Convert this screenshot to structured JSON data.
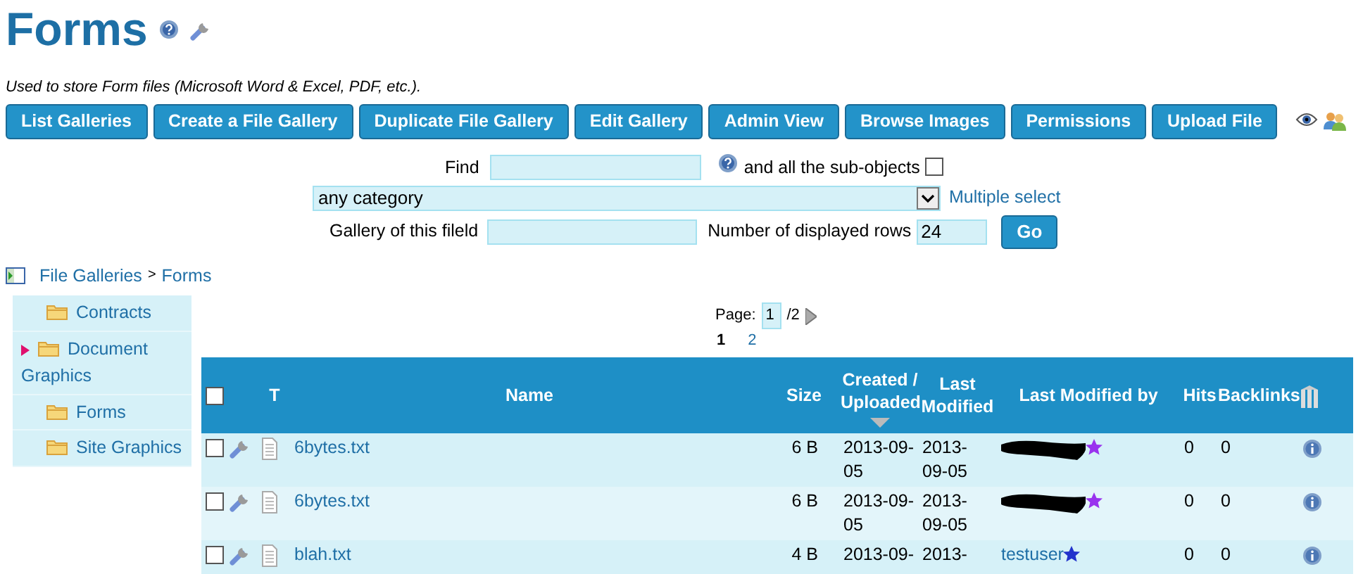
{
  "page": {
    "title": "Forms",
    "description": "Used to store Form files (Microsoft Word & Excel, PDF, etc.)."
  },
  "buttons": [
    {
      "label": "List Galleries"
    },
    {
      "label": "Create a File Gallery"
    },
    {
      "label": "Duplicate File Gallery"
    },
    {
      "label": "Edit Gallery"
    },
    {
      "label": "Admin View"
    },
    {
      "label": "Browse Images"
    },
    {
      "label": "Permissions"
    },
    {
      "label": "Upload File"
    }
  ],
  "search": {
    "find_label": "Find",
    "sub_objects_label": "and all the sub-objects",
    "sub_objects_checked": false,
    "category": "any category",
    "multiple_select": "Multiple select",
    "gallery_label": "Gallery of this fileld",
    "rows_label": "Number of displayed rows",
    "rows_value": "24",
    "go": "Go"
  },
  "breadcrumb": {
    "items": [
      "File Galleries",
      "Forms"
    ],
    "separator": ">"
  },
  "sidebar": [
    {
      "label": "Contracts",
      "has_children": false
    },
    {
      "label": "Document Graphics",
      "has_children": true
    },
    {
      "label": "Forms",
      "has_children": false
    },
    {
      "label": "Site Graphics",
      "has_children": false
    }
  ],
  "pagination": {
    "label": "Page:",
    "current": "1",
    "total": "/2",
    "pages": [
      {
        "label": "1",
        "selected": true
      },
      {
        "label": "2",
        "selected": false
      }
    ]
  },
  "table": {
    "select_all_checked": false,
    "columns": [
      {
        "label": "T",
        "sorted": false
      },
      {
        "label": "Name",
        "sorted": false
      },
      {
        "label": "Size",
        "sorted": false
      },
      {
        "label": "Created / Uploaded",
        "sorted": true
      },
      {
        "label": "Last Modified",
        "sorted": false
      },
      {
        "label": "Last Modified by",
        "sorted": false
      },
      {
        "label": "Hits",
        "sorted": false
      },
      {
        "label": "Backlinks",
        "sorted": false
      }
    ],
    "rows": [
      {
        "checked": false,
        "name": "6bytes.txt",
        "size": "6 B",
        "created": "2013-09-05",
        "modified": "2013-09-05",
        "redacted": true,
        "color": "#9933ee",
        "hits": "0",
        "backlinks": "0"
      },
      {
        "checked": false,
        "name": "6bytes.txt",
        "size": "6 B",
        "created": "2013-09-05",
        "modified": "2013-09-05",
        "redacted": true,
        "color": "#9933ee",
        "hits": "0",
        "backlinks": "0"
      },
      {
        "checked": false,
        "name": "blah.txt",
        "size": "4 B",
        "created": "2013-09-",
        "modified": "2013-",
        "modified_by": "testuser",
        "redacted": false,
        "color": "#2233cc",
        "hits": "0",
        "backlinks": "0"
      }
    ]
  }
}
